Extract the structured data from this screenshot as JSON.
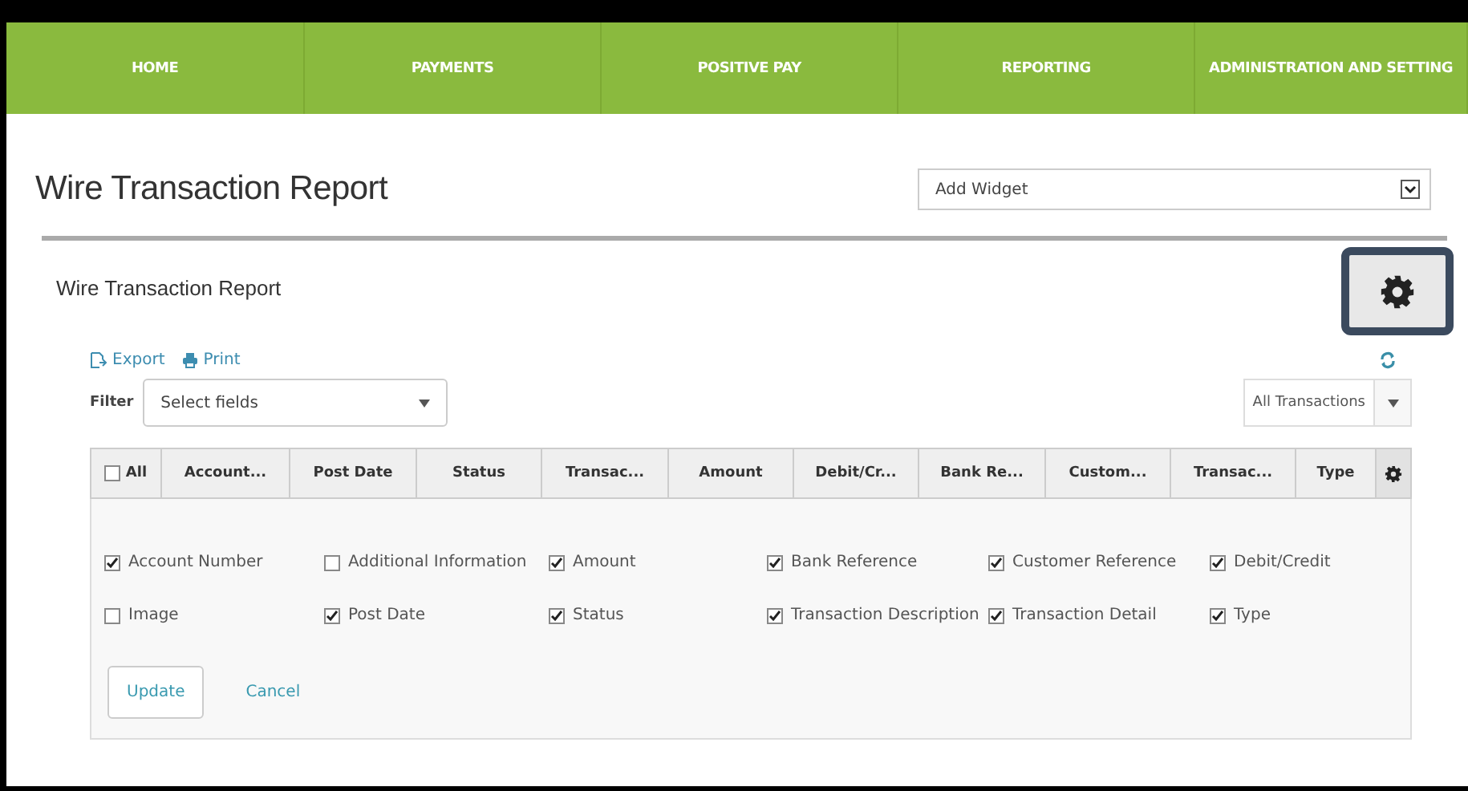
{
  "nav": [
    {
      "label": "HOME"
    },
    {
      "label": "PAYMENTS"
    },
    {
      "label": "POSITIVE PAY"
    },
    {
      "label": "REPORTING"
    },
    {
      "label": "ADMINISTRATION AND SETTING"
    }
  ],
  "page_title": "Wire Transaction Report",
  "widget_select": {
    "value": "Add Widget"
  },
  "panel": {
    "title": "Wire Transaction Report",
    "actions": [
      {
        "label": "Export",
        "kind": "export"
      },
      {
        "label": "Print",
        "kind": "print"
      }
    ],
    "filter": {
      "label": "Filter",
      "placeholder": "Select fields"
    },
    "transactions_select": {
      "value": "All Transactions"
    },
    "table": {
      "select_all": {
        "label": "All",
        "checked": false
      },
      "columns": [
        "Account...",
        "Post Date",
        "Status",
        "Transac...",
        "Amount",
        "Debit/Cr...",
        "Bank Re...",
        "Custom...",
        "Transac...",
        "Type"
      ]
    },
    "fields": [
      {
        "label": "Account Number",
        "checked": true
      },
      {
        "label": "Additional Information",
        "checked": false
      },
      {
        "label": "Amount",
        "checked": true
      },
      {
        "label": "Bank Reference",
        "checked": true
      },
      {
        "label": "Customer Reference",
        "checked": true
      },
      {
        "label": "Debit/Credit",
        "checked": true
      },
      {
        "label": "Image",
        "checked": false
      },
      {
        "label": "Post Date",
        "checked": true
      },
      {
        "label": "Status",
        "checked": true
      },
      {
        "label": "Transaction Description",
        "checked": true
      },
      {
        "label": "Transaction Detail",
        "checked": true
      },
      {
        "label": "Type",
        "checked": true
      }
    ],
    "buttons": [
      {
        "label": "Update",
        "kind": "primary"
      },
      {
        "label": "Cancel",
        "kind": "link"
      }
    ]
  }
}
